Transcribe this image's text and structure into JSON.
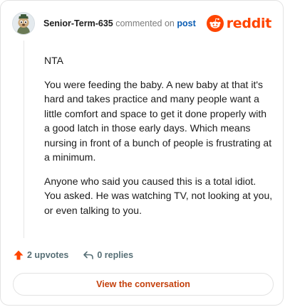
{
  "comment": {
    "author": "Senior-Term-635",
    "action": "commented on",
    "post_link": "post",
    "paragraphs": [
      "NTA",
      "You were feeding the baby. A new baby at that it's hard and takes practice and many people want a little comfort and space to get it done properly with a good latch in those early days. Which means nursing in front of a bunch of people is frustrating at a minimum.",
      "Anyone who said you caused this is a total idiot. You asked. He was watching TV, not looking at you, or even talking to you."
    ]
  },
  "brand": {
    "name": "reddit",
    "icon": "reddit-snoo-icon",
    "color": "#ff4500"
  },
  "footer": {
    "upvotes": "2 upvotes",
    "replies": "0 replies",
    "upvote_icon": "upvote-arrow-icon",
    "reply_icon": "reply-arrow-icon",
    "upvote_color": "#ff4500"
  },
  "cta": {
    "label": "View the conversation"
  }
}
